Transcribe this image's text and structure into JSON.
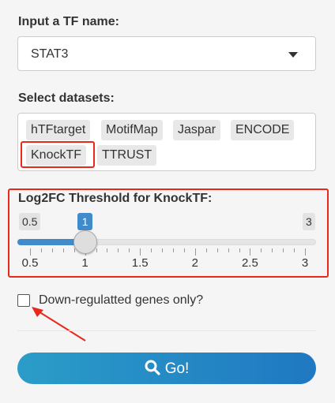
{
  "tf_label": "Input a TF name:",
  "tf_value": "STAT3",
  "datasets_label": "Select datasets:",
  "datasets": [
    "hTFtarget",
    "MotifMap",
    "Jaspar",
    "ENCODE",
    "KnockTF",
    "TTRUST"
  ],
  "threshold_label": "Log2FC Threshold for KnockTF:",
  "slider": {
    "min": "0.5",
    "max": "3",
    "value": "1",
    "value_num": 1,
    "ticks": [
      "0.5",
      "1",
      "1.5",
      "2",
      "2.5",
      "3"
    ]
  },
  "checkbox_label": "Down-regulatted genes only?",
  "go_label": "Go!",
  "colors": {
    "accent": "#428bca",
    "highlight": "#e8291c",
    "button": "#1f78c2"
  }
}
